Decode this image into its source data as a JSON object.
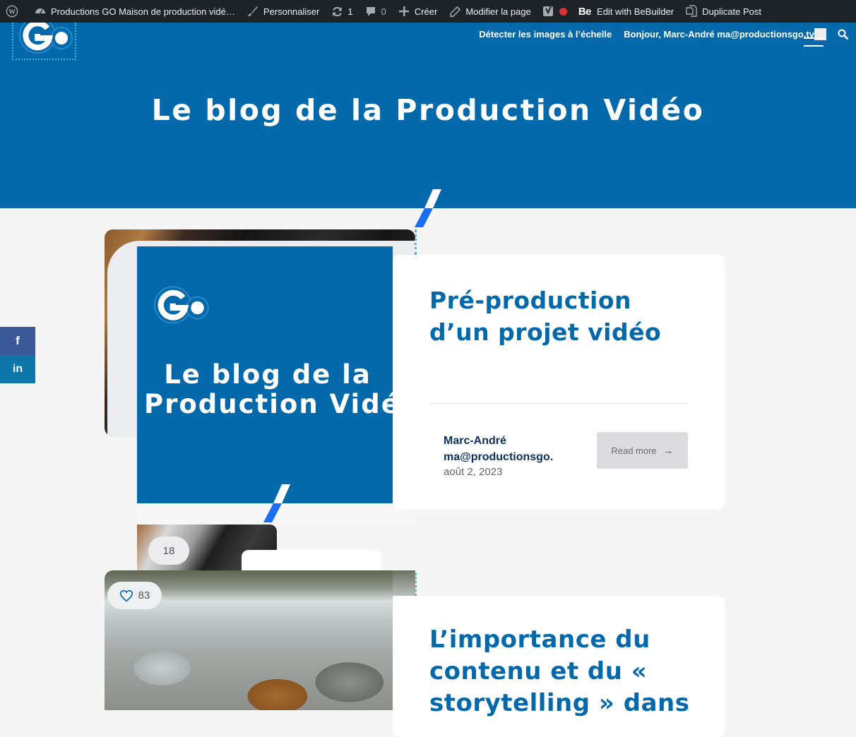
{
  "adminbar": {
    "site_name": "Productions GO Maison de production vidé…",
    "customize": "Personnaliser",
    "updates_count": "1",
    "comments_count": "0",
    "new": "Créer",
    "edit_page": "Modifier la page",
    "bebuilder": "Edit with BeBuilder",
    "bebuilder_logo": "Be",
    "duplicate": "Duplicate Post"
  },
  "header": {
    "logo_text": "Go",
    "detect_images": "Détecter les images à l’échelle",
    "greeting": "Bonjour, Marc-André ma@productionsgo.tv",
    "hero_title": "Le blog de la Production Vidéo"
  },
  "social": {
    "facebook": "f",
    "linkedin": "in"
  },
  "posts": [
    {
      "image_title_line1": "Le blog de la",
      "image_title_line2": "Production Vidéo",
      "mini_count": "18",
      "title": "Pré-production d’un projet vidéo",
      "author_line1": "Marc-André",
      "author_line2": "ma@productionsgo.",
      "date": "août 2, 2023",
      "read_more": "Read more"
    },
    {
      "likes": "83",
      "title": "L’importance du contenu et du « storytelling » dans"
    }
  ],
  "colors": {
    "brand_blue": "#0369ab",
    "admin_bar": "#1d2327",
    "accent_blue": "#1a6ef5",
    "facebook": "#3b5998",
    "linkedin": "#0e76a8"
  }
}
